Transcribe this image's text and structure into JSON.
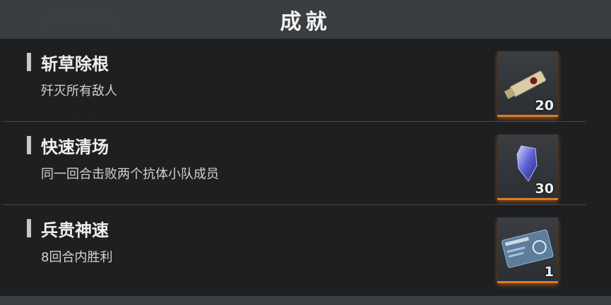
{
  "header": {
    "title": "成就"
  },
  "achievements": [
    {
      "title": "斩草除根",
      "desc": "歼灭所有敌人",
      "reward": {
        "icon": "usb-key-icon",
        "count": "20"
      }
    },
    {
      "title": "快速清场",
      "desc": "同一回合击败两个抗体小队成员",
      "reward": {
        "icon": "blue-crystal-icon",
        "count": "30"
      }
    },
    {
      "title": "兵贵神速",
      "desc": "8回合内胜利",
      "reward": {
        "icon": "id-card-icon",
        "count": "1"
      }
    }
  ],
  "colors": {
    "accent": "#e07a22",
    "panel": "#1c1e20",
    "header": "#3c3f42"
  }
}
